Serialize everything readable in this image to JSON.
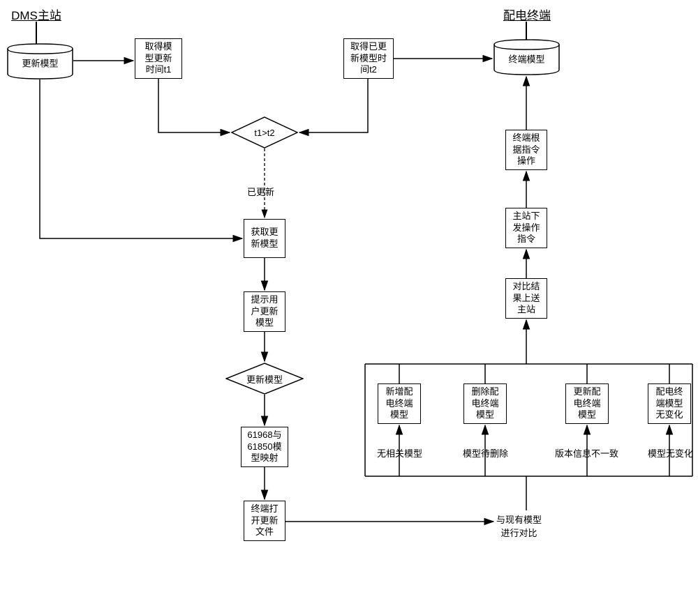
{
  "headers": {
    "left": "DMS主站",
    "right": "配电终端"
  },
  "cylinders": {
    "update_model": "更新模型",
    "terminal_model": "终端模型"
  },
  "boxes": {
    "get_t1": "取得模\n型更新\n时间t1",
    "get_t2": "取得已更\n新模型时\n间t2",
    "fetch_update": "获取更\n新模型",
    "prompt_user": "提示用\n户更新\n模型",
    "map_models": "61968与\n61850模\n型映射",
    "open_file": "终端打\n开更新\n文件",
    "add_term": "新增配\n电终端\n模型",
    "del_term": "删除配\n电终端\n模型",
    "upd_term": "更新配\n电终端\n模型",
    "nochg_term": "配电终\n端模型\n无变化",
    "send_result": "对比结\n果上送\n主站",
    "issue_cmd": "主站下\n发操作\n指令",
    "term_exec": "终端根\n据指令\n操作"
  },
  "diamonds": {
    "t1gt": "t1>t2",
    "update_model_q": "更新模型"
  },
  "labels": {
    "updated": "已更新",
    "compare_existing": "与现有模型\n进行对比",
    "no_related": "无相关模型",
    "to_delete": "模型待删除",
    "ver_diff": "版本信息不一致",
    "no_change": "模型无变化"
  }
}
